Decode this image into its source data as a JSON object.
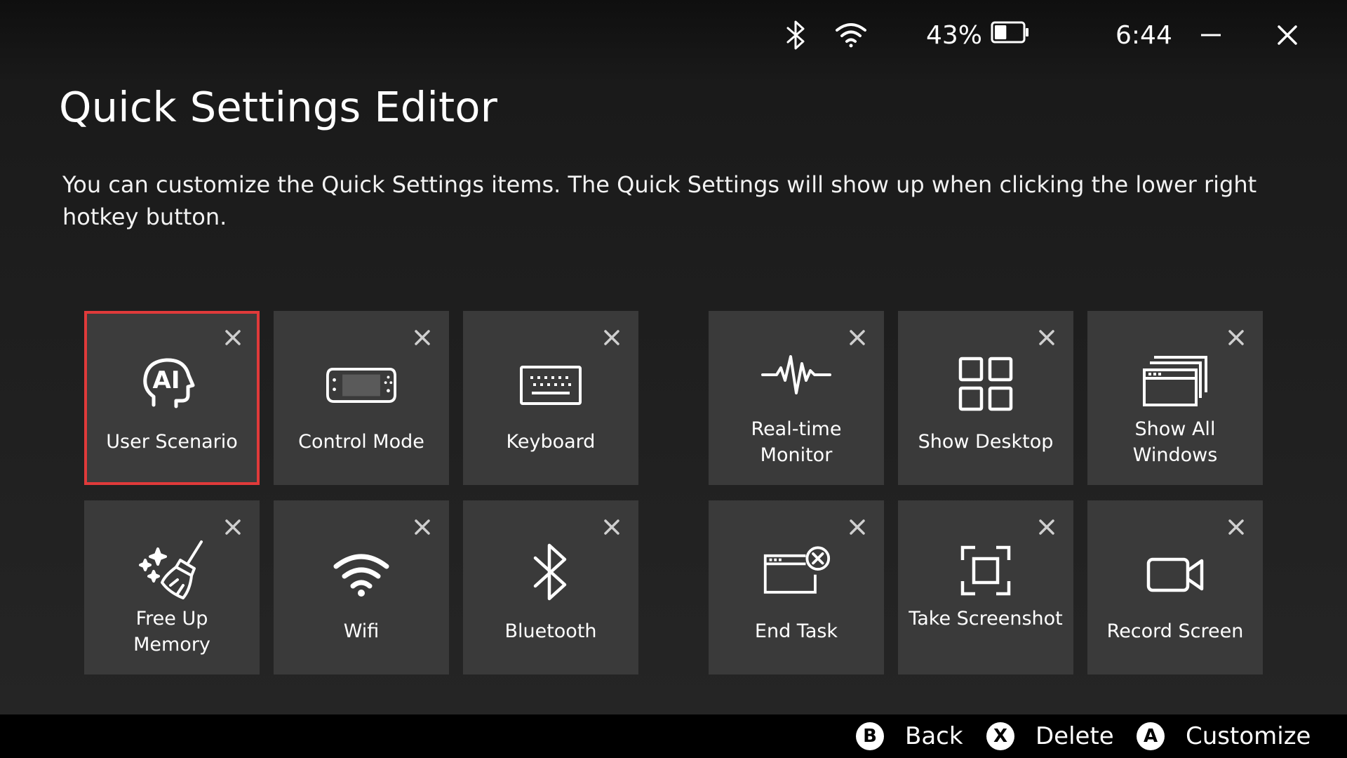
{
  "status": {
    "battery_percent": "43%",
    "battery_level": 0.43,
    "time": "6:44",
    "icons": [
      "bluetooth-icon",
      "wifi-icon",
      "battery-icon",
      "minimize-icon",
      "close-icon"
    ]
  },
  "header": {
    "title": "Quick Settings Editor",
    "description": "You can customize the Quick Settings items. The Quick Settings will show up when clicking the lower right hotkey button."
  },
  "tiles": [
    {
      "label": "User Scenario",
      "icon": "ai-user-scenario-icon",
      "selected": true
    },
    {
      "label": "Control Mode",
      "icon": "handheld-console-icon",
      "selected": false
    },
    {
      "label": "Keyboard",
      "icon": "keyboard-icon",
      "selected": false
    },
    {
      "label": "Real-time Monitor",
      "icon": "pulse-monitor-icon",
      "selected": false
    },
    {
      "label": "Show Desktop",
      "icon": "desktop-grid-icon",
      "selected": false
    },
    {
      "label": "Show All Windows",
      "icon": "stacked-windows-icon",
      "selected": false
    },
    {
      "label": "Free Up Memory",
      "icon": "broom-sparkle-icon",
      "selected": false
    },
    {
      "label": "Wifi",
      "icon": "wifi-icon",
      "selected": false
    },
    {
      "label": "Bluetooth",
      "icon": "bluetooth-icon",
      "selected": false
    },
    {
      "label": "End Task",
      "icon": "window-close-icon",
      "selected": false
    },
    {
      "label": "Take Screenshot",
      "icon": "screenshot-frame-icon",
      "selected": false
    },
    {
      "label": "Record Screen",
      "icon": "video-camera-icon",
      "selected": false
    }
  ],
  "hints": {
    "back": {
      "glyph": "B",
      "label": "Back"
    },
    "delete": {
      "glyph": "X",
      "label": "Delete"
    },
    "customize": {
      "glyph": "A",
      "label": "Customize"
    }
  },
  "colors": {
    "selected_border": "#e03a3a",
    "tile_bg": "#3a3a3a",
    "background": "#262626",
    "hint_bar": "#000000"
  }
}
